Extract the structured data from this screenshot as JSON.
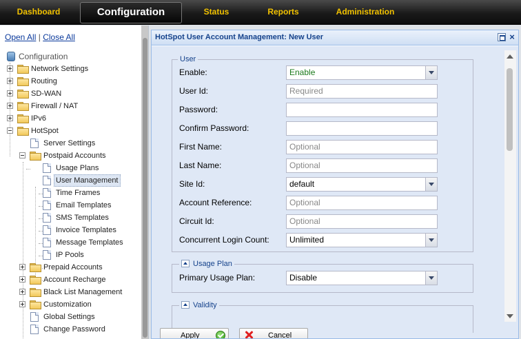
{
  "nav": {
    "tabs": [
      {
        "label": "Dashboard"
      },
      {
        "label": "Configuration"
      },
      {
        "label": "Status"
      },
      {
        "label": "Reports"
      },
      {
        "label": "Administration"
      }
    ],
    "active": "Configuration"
  },
  "sidebar": {
    "open_all": "Open All",
    "separator": "|",
    "close_all": "Close All",
    "root": "Configuration",
    "items": [
      {
        "label": "Network Settings"
      },
      {
        "label": "Routing"
      },
      {
        "label": "SD-WAN"
      },
      {
        "label": "Firewall / NAT"
      },
      {
        "label": "IPv6"
      },
      {
        "label": "HotSpot"
      },
      {
        "label": "Server Settings"
      },
      {
        "label": "Postpaid Accounts"
      },
      {
        "label": "Usage Plans"
      },
      {
        "label": "User Management"
      },
      {
        "label": "Time Frames"
      },
      {
        "label": "Email Templates"
      },
      {
        "label": "SMS Templates"
      },
      {
        "label": "Invoice Templates"
      },
      {
        "label": "Message Templates"
      },
      {
        "label": "IP Pools"
      },
      {
        "label": "Prepaid Accounts"
      },
      {
        "label": "Account Recharge"
      },
      {
        "label": "Black List Management"
      },
      {
        "label": "Customization"
      },
      {
        "label": "Global Settings"
      },
      {
        "label": "Change Password"
      }
    ],
    "selected": "User Management"
  },
  "window": {
    "title": "HotSpot User Account Management: New User",
    "user_section": {
      "legend": "User",
      "fields": [
        {
          "label": "Enable:",
          "value": "Enable",
          "placeholder": ""
        },
        {
          "label": "User Id:",
          "value": "",
          "placeholder": "Required"
        },
        {
          "label": "Password:",
          "value": "",
          "placeholder": ""
        },
        {
          "label": "Confirm Password:",
          "value": "",
          "placeholder": ""
        },
        {
          "label": "First Name:",
          "value": "",
          "placeholder": "Optional"
        },
        {
          "label": "Last Name:",
          "value": "",
          "placeholder": "Optional"
        },
        {
          "label": "Site Id:",
          "value": "default",
          "placeholder": ""
        },
        {
          "label": "Account Reference:",
          "value": "",
          "placeholder": "Optional"
        },
        {
          "label": "Circuit Id:",
          "value": "",
          "placeholder": "Optional"
        },
        {
          "label": "Concurrent Login Count:",
          "value": "Unlimited",
          "placeholder": ""
        }
      ]
    },
    "usage_plan_section": {
      "legend": "Usage Plan",
      "field_label": "Primary Usage Plan:",
      "field_value": "Disable"
    },
    "validity_section": {
      "legend": "Validity"
    },
    "buttons": {
      "apply": "Apply",
      "cancel": "Cancel"
    }
  },
  "colors": {
    "nav_tab": "#f2c200",
    "accent_text": "#15428b",
    "panel_bg": "#dfe8f6",
    "enable_text": "#1a7a1a"
  }
}
